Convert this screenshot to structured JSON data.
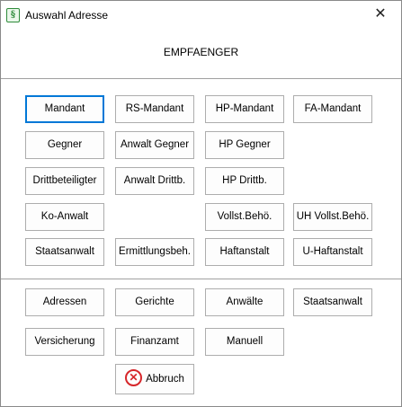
{
  "window": {
    "title": "Auswahl Adresse",
    "app_icon_glyph": "§",
    "close_glyph": "✕",
    "heading": "EMPFAENGER"
  },
  "row1": [
    "Mandant",
    "RS-Mandant",
    "HP-Mandant",
    "FA-Mandant"
  ],
  "row2": [
    "Gegner",
    "Anwalt Gegner",
    "HP Gegner"
  ],
  "row3": [
    "Drittbeteiligter",
    "Anwalt Drittb.",
    "HP Drittb."
  ],
  "row4": [
    "Ko-Anwalt",
    "Vollst.Behö.",
    "UH Vollst.Behö."
  ],
  "row5": [
    "Staatsanwalt",
    "Ermittlungsbeh.",
    "Haftanstalt",
    "U-Haftanstalt"
  ],
  "lists": [
    "Adressen",
    "Gerichte",
    "Anwälte",
    "Staatsanwalt",
    "Versicherung",
    "Finanzamt",
    "Manuell"
  ],
  "abort": {
    "label": "Abbruch",
    "icon": "error-circle-icon",
    "icon_glyph": "✕"
  },
  "colors": {
    "default_border": "#0078d7",
    "abort_icon": "#d6262a",
    "app_icon": "#2e8b3a"
  }
}
